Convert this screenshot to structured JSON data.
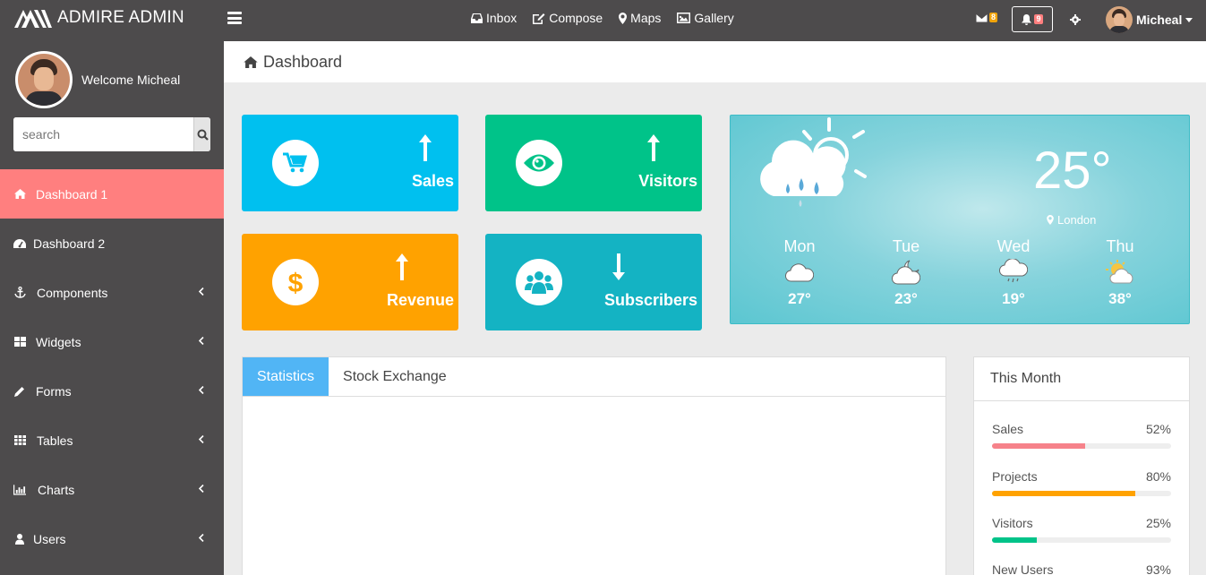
{
  "brand": {
    "name": "ADMIRE ADMIN"
  },
  "topnav": [
    {
      "label": "Inbox",
      "icon": "inbox-icon"
    },
    {
      "label": "Compose",
      "icon": "edit-icon"
    },
    {
      "label": "Maps",
      "icon": "map-marker-icon"
    },
    {
      "label": "Gallery",
      "icon": "image-icon"
    }
  ],
  "notifications": {
    "mail_count": "8",
    "bell_count": "9",
    "mail_color": "#f0a30a",
    "bell_color": "#ff7f7f"
  },
  "user": {
    "name": "Micheal"
  },
  "sidebar": {
    "welcome": "Welcome Micheal",
    "search_placeholder": "search",
    "items": [
      {
        "label": "Dashboard 1",
        "icon": "home-icon",
        "active": true
      },
      {
        "label": "Dashboard 2",
        "icon": "dashboard-icon"
      },
      {
        "label": "Components",
        "icon": "anchor-icon"
      },
      {
        "label": "Widgets",
        "icon": "widgets-icon"
      },
      {
        "label": "Forms",
        "icon": "pencil-icon"
      },
      {
        "label": "Tables",
        "icon": "table-icon"
      },
      {
        "label": "Charts",
        "icon": "chart-icon"
      },
      {
        "label": "Users",
        "icon": "user-icon"
      }
    ],
    "active_color": "#ff7f7f"
  },
  "page": {
    "title": "Dashboard"
  },
  "tiles": [
    {
      "label": "Sales",
      "color": "#00c0ef",
      "arrow": "up",
      "icon": "cart-icon"
    },
    {
      "label": "Visitors",
      "color": "#00c389",
      "arrow": "up",
      "icon": "eye-icon"
    },
    {
      "label": "Revenue",
      "color": "#ffa200",
      "arrow": "up",
      "icon": "dollar-icon"
    },
    {
      "label": "Subscribers",
      "color": "#14b3c3",
      "arrow": "down",
      "icon": "users-icon"
    }
  ],
  "weather": {
    "temp": "25°",
    "city": "London",
    "days": [
      {
        "name": "Mon",
        "temp": "27°",
        "icon": "cloud-icon"
      },
      {
        "name": "Tue",
        "temp": "23°",
        "icon": "cloud-moon-icon"
      },
      {
        "name": "Wed",
        "temp": "19°",
        "icon": "cloud-rain-icon"
      },
      {
        "name": "Thu",
        "temp": "38°",
        "icon": "sun-cloud-icon"
      }
    ]
  },
  "stats": {
    "tabs": [
      "Statistics",
      "Stock Exchange"
    ]
  },
  "month": {
    "title": "This Month",
    "rows": [
      {
        "label": "Sales",
        "value": "52%",
        "pct": 52,
        "color": "#f6828a"
      },
      {
        "label": "Projects",
        "value": "80%",
        "pct": 80,
        "color": "#ffa200"
      },
      {
        "label": "Visitors",
        "value": "25%",
        "pct": 25,
        "color": "#00c389"
      },
      {
        "label": "New Users",
        "value": "93%",
        "pct": 93,
        "color": "#51b5f5"
      }
    ]
  }
}
